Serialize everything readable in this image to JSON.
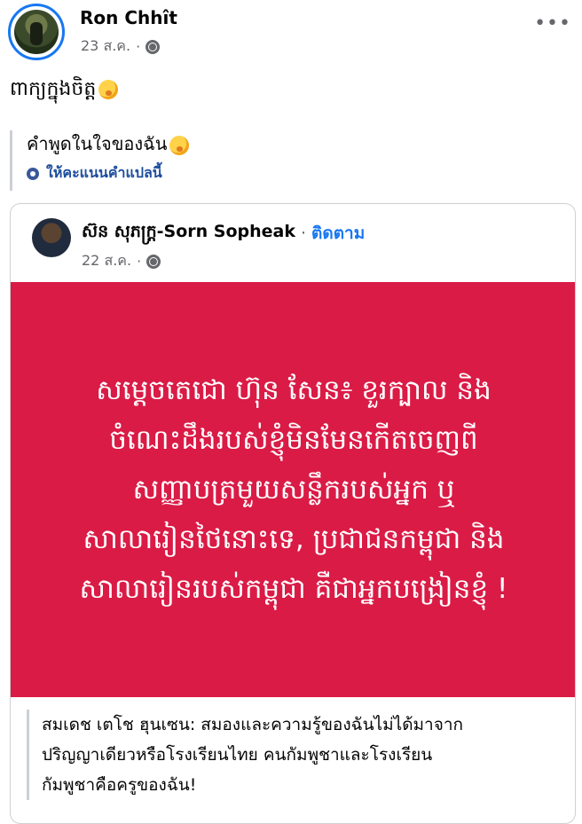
{
  "post": {
    "author": "Ron Chhît",
    "date": "23 ส.ค.",
    "separator": "·",
    "text": "ពាក្យក្នុងចិត្ត",
    "emoji": "yawning-face-emoji",
    "more_menu": "•••"
  },
  "translation": {
    "text": "คำพูดในใจของฉัน",
    "rate_label": "ให้คะแนนคำแปลนี้"
  },
  "shared_post": {
    "author": "ស៊ន សុភក្រ្ត-Sorn Sopheak",
    "follow_label": "ติดตาม",
    "date": "22 ส.ค.",
    "separator": "·",
    "image_text_lines": [
      "សម្តេចតេជោ ហ៊ុន សែន៖ ខួរក្បាល និង",
      "ចំណេះដឹងរបស់ខ្ញុំមិនមែនកើតចេញពី",
      "សញ្ញាបត្រមួយសន្លឹករបស់អ្នក ឬ",
      "សាលារៀនថៃនោះទេ, ប្រជាជនកម្ពុជា និង",
      "សាលារៀនរបស់កម្ពុជា គឺជាអ្នកបង្រៀនខ្ញុំ !"
    ],
    "caption_lines": [
      "สมเดช เตโช ฮุนเซน: สมองและความรู้ของฉันไม่ได้มาจาก",
      "ปริญญาเดียวหรือโรงเรียนไทย คนกัมพูชาและโรงเรียน",
      "กัมพูชาคือครูของฉัน!"
    ],
    "card_color": "#da1b46"
  },
  "colors": {
    "link_blue": "#1877f2",
    "meta_gray": "#65676b"
  }
}
